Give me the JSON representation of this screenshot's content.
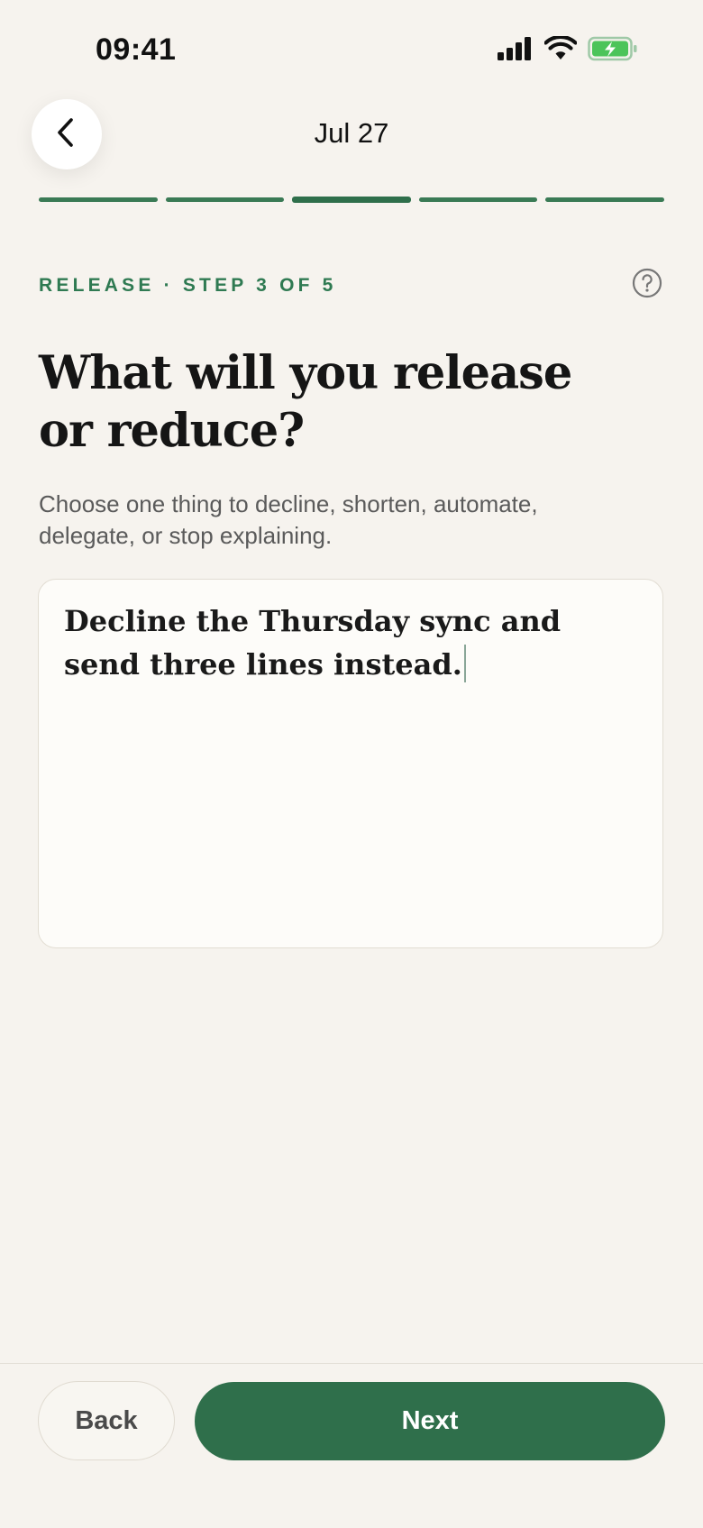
{
  "status_bar": {
    "time": "09:41"
  },
  "header": {
    "date": "Jul 27"
  },
  "progress": {
    "total_steps": 5,
    "current_step": 3
  },
  "step": {
    "label": "RELEASE · STEP 3 OF 5"
  },
  "main": {
    "heading_line1": "What will you release",
    "heading_line2": "or reduce?",
    "subtitle": "Choose one thing to decline, shorten, automate, delegate, or stop explaining.",
    "input_value": "Decline the Thursday sync and send three lines instead."
  },
  "footer": {
    "back_label": "Back",
    "next_label": "Next"
  },
  "colors": {
    "accent": "#2f6f4b",
    "background": "#f6f3ee",
    "battery_fill": "#4cc45a"
  }
}
